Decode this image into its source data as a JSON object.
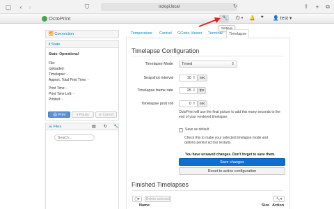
{
  "browser": {
    "url": "octopi.local"
  },
  "navbar": {
    "brand": "OctoPrint",
    "user": "test",
    "tooltip": "Settings"
  },
  "connection": {
    "title": "Connection"
  },
  "state": {
    "title": "State",
    "status": "State: Operational",
    "file": "File:",
    "uploaded": "Uploaded:",
    "timelapse": "Timelapse: -",
    "total_print_time": "Approx. Total Print Time: -",
    "print_time": "Print Time: -",
    "print_time_left": "Print Time Left: -",
    "printed": "Printed: -",
    "print_label": "Print",
    "pause_label": "Pause",
    "cancel_label": "Cancel"
  },
  "files": {
    "title": "Files",
    "search_placeholder": "Search..."
  },
  "tabs": [
    "Temperature",
    "Control",
    "GCode Viewer",
    "Terminal",
    "Timelapse"
  ],
  "timelapse": {
    "heading": "Timelapse Configuration",
    "mode_label": "Timelapse Mode",
    "mode_value": "Timed",
    "interval_label": "Snapshot interval",
    "interval_value": "10",
    "interval_unit": "sec",
    "framerate_label": "Timelapse frame rate",
    "framerate_value": "25",
    "framerate_unit": "fps",
    "postroll_label": "Timelapse post roll",
    "postroll_value": "0",
    "postroll_unit": "sec",
    "postroll_note": "OctoPrint will use the final picture to add this many seconds to the end of your rendered timelapse.",
    "save_default_label": "Save as default",
    "save_default_note": "Check this to make your selected timelapse mode and options persist across restarts.",
    "unsaved_warning": "You have unsaved changes. Don't forget to save them.",
    "save_button": "Save changes",
    "reset_button": "Reset to active configuration"
  },
  "finished": {
    "heading": "Finished Timelapses",
    "delete_selected": "Delete selected",
    "col_name": "Name",
    "col_size": "Size",
    "col_action": "Action"
  },
  "colors": {
    "primary": "#0088cc",
    "save_button": "#0d6fd3",
    "arrow": "#e0201b"
  }
}
